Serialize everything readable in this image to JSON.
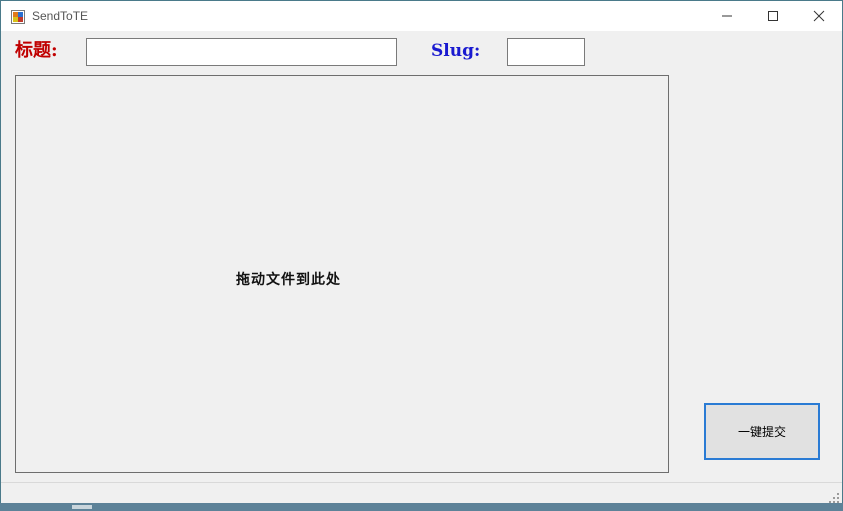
{
  "window": {
    "title": "SendToTE",
    "icons": {
      "app": "app-icon",
      "minimize": "minimize-icon",
      "maximize": "maximize-icon",
      "close": "close-icon"
    }
  },
  "form": {
    "title_label": "标题:",
    "title_value": "",
    "slug_label": "Slug:",
    "slug_value": ""
  },
  "dropzone": {
    "label": "拖动文件到此处"
  },
  "actions": {
    "submit_label": "一键提交"
  },
  "colors": {
    "title_label": "#c00000",
    "slug_label": "#1a1ad0",
    "submit_border": "#2a7bd4"
  }
}
